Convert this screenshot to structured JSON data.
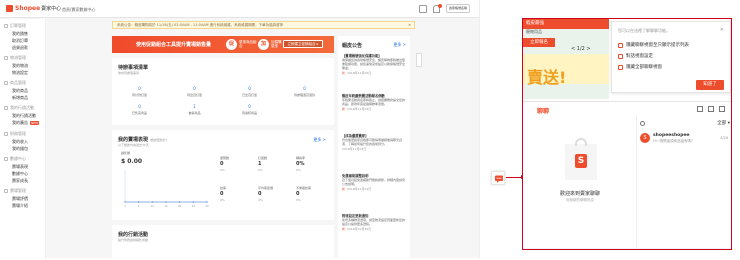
{
  "header": {
    "logo": "Shopee",
    "logo_sub": "賣家中心",
    "breadcrumb": "首頁/賣家數據中心",
    "account": "賣家帳號名稱"
  },
  "sidebar": [
    {
      "title": "訂單管理",
      "items": [
        "我的銷售",
        "取消訂單",
        "退貨退款"
      ]
    },
    {
      "title": "物流管理",
      "items": [
        "我的物流",
        "物流設定"
      ]
    },
    {
      "title": "商品管理",
      "items": [
        "我的商品",
        "新增商品"
      ]
    },
    {
      "title": "我的行銷活動",
      "items": [
        "我的行銷活動",
        "我的廣告"
      ],
      "badge": "NEW"
    },
    {
      "title": "財務管理",
      "items": [
        "我的收入",
        "我的錢包"
      ]
    },
    {
      "title": "數據中心",
      "items": [
        "賣場表現",
        "數據中心",
        "賣家成長"
      ]
    },
    {
      "title": "賣場管理",
      "items": [
        "賣場評價",
        "賣場介紹"
      ]
    }
  ],
  "notice": {
    "text": "系統公告：蝦皮購物將於 11/16(五) 02:00AM - 11:00AM 進行系統維護，系統維護期間，下單功能將暫停",
    "close": "✕"
  },
  "banner": {
    "title": "使用促銷組合工具提升賣場銷售量",
    "badge1": "促",
    "label1": "優惠商品組合",
    "badge2": "加",
    "label2": "加價購優惠",
    "button": "立即建立促銷組合 ▸"
  },
  "todo": {
    "title": "待辦事項清單",
    "subtitle": "你的待處理事項",
    "cells": [
      {
        "value": "0",
        "label": "待付款訂單"
      },
      {
        "value": "0",
        "label": "待出貨訂單"
      },
      {
        "value": "0",
        "label": "已出貨訂單"
      },
      {
        "value": "0",
        "label": "待處理退貨退款"
      },
      {
        "value": "0",
        "label": "已售完商品"
      },
      {
        "value": "1",
        "label": "被禁商品"
      },
      {
        "value": "0",
        "label": "待審核商品"
      }
    ]
  },
  "performance": {
    "title": "我的賣場表現",
    "title_note": "(數據更新於)",
    "subtitle": "以下數據均為過去30天",
    "more": "更多 >",
    "sales_label": "銷售額",
    "sales_value": "$ 0.00",
    "metrics": [
      {
        "label": "瀏覽數",
        "value": "0",
        "change": "0%"
      },
      {
        "label": "訂單數",
        "value": "1",
        "change": "0%"
      },
      {
        "label": "轉換率",
        "value": "0%",
        "change": "0%"
      },
      {
        "label": "訪客",
        "value": "0",
        "change": "0%"
      },
      {
        "label": "平均客單價",
        "value": "0",
        "change": "0%"
      },
      {
        "label": "不重複訪客",
        "value": "0",
        "change": "0%"
      }
    ]
  },
  "marketing": {
    "title": "我的行銷活動",
    "subtitle": "提升你的賣場銷售成績"
  },
  "announcements": {
    "title": "蝦皮公告",
    "more": "更多 >",
    "items": [
      {
        "title": "【賣場帳號強化保護功能】",
        "body": "為保護您的賣場帳號安全，蝦皮購物即將推出雙重驗證功能，請您盡快完成設定以確保帳號安全無虞。",
        "date": "2018年11月06日",
        "tag": "新"
      },
      {
        "title": "蝦皮年終慶熱賣活動報名倒數",
        "body": "年終慶活動報名即將截止，請把握機會提交您的商品，搶攻年底最強購物季流量。",
        "date": "2018年11月05日",
        "tag": "新"
      },
      {
        "title": "【成為優選賣家】",
        "body": "符合優選賣家資格即可獲得專屬標章與曝光資源，了解如何提升您的賣場評分。",
        "date": "2018年11月03日",
        "tag": ""
      },
      {
        "title": "免運補助調整說明",
        "body": "自下個月起免運補助門檻將調整，詳細內容請見公告說明。",
        "date": "2018年11月01日",
        "tag": "新"
      },
      {
        "title": "物流設定更新通知",
        "body": "新增多種物流選項，請至物流設定頁面更新您的設定以提供更多選擇。",
        "date": "2018年10月30日",
        "tag": "新"
      }
    ]
  },
  "chat_button": {
    "label": "聊聊"
  },
  "zoom": {
    "ad_top": "蝦皮最強",
    "ad_top2": "寵物用品",
    "ad_tag": "立即報名",
    "ad_pager": "< 1/2 >",
    "ad_big": "賣送!",
    "tips_title": "您可以在這裡了解聊聊功能。",
    "tips_close": "✕",
    "tips": [
      "隱藏聊聊視窗至只顯示提示列表",
      "對話視窗設定",
      "隱藏全部聊聊視窗"
    ],
    "got_it": "知道了",
    "chat_title": "聊聊",
    "welcome": "歡迎來到賣家聊聊",
    "welcome_sub": "尚無新的聊聊訊息",
    "filter": "全部 ▾",
    "conversation": {
      "name": "shopeeshopee",
      "preview": "Hi~請問這項商品還有嗎?",
      "date": "4/26"
    }
  },
  "chart_data": {
    "type": "line",
    "title": "",
    "x": [
      "1",
      "5",
      "10",
      "15",
      "20",
      "25",
      "30"
    ],
    "series": [
      {
        "values": [
          0,
          0,
          0,
          0,
          0,
          0,
          0
        ]
      }
    ],
    "ylim": [
      0,
      1
    ]
  }
}
